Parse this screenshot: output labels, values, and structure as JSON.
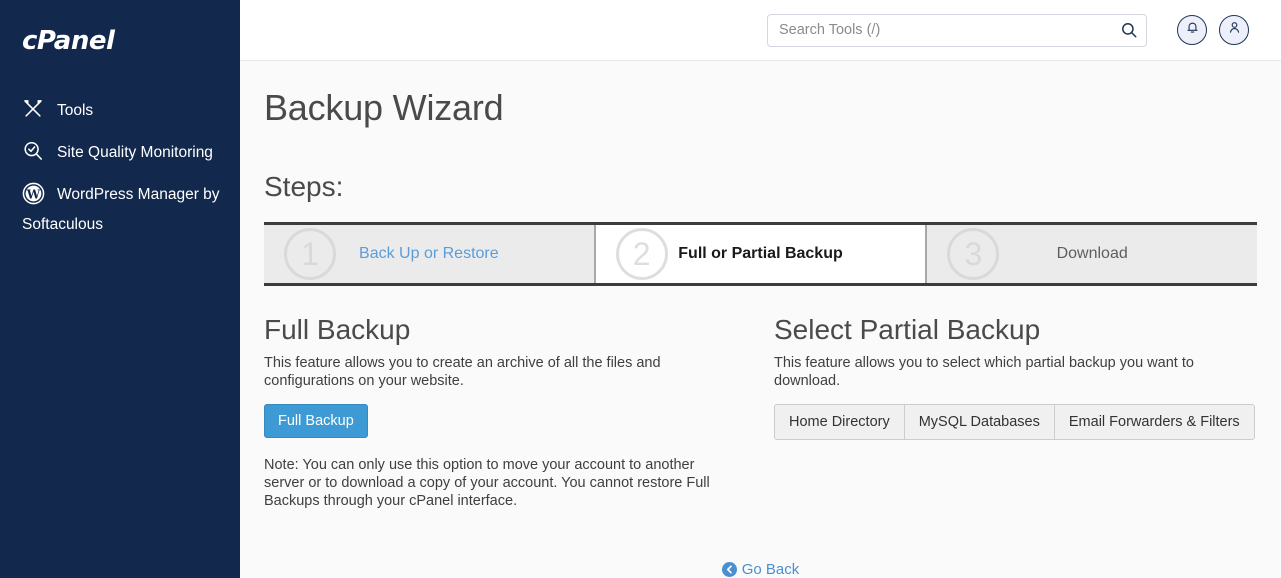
{
  "sidebar": {
    "brand": "cPanel",
    "items": [
      {
        "label": "Tools",
        "icon": "tools-icon"
      },
      {
        "label": "Site Quality Monitoring",
        "icon": "site-quality-icon"
      },
      {
        "label": "WordPress Manager by Softaculous",
        "icon": "wordpress-icon"
      }
    ]
  },
  "header": {
    "search": {
      "placeholder": "Search Tools (/)",
      "value": ""
    },
    "notifications_icon": "bell-icon",
    "account_icon": "user-icon"
  },
  "page": {
    "title": "Backup Wizard",
    "steps_title": "Steps:",
    "steps": [
      {
        "number": "1",
        "label": "Back Up or Restore",
        "state": "link"
      },
      {
        "number": "2",
        "label": "Full or Partial Backup",
        "state": "active"
      },
      {
        "number": "3",
        "label": "Download",
        "state": "inactive"
      }
    ],
    "full_backup": {
      "title": "Full Backup",
      "description": "This feature allows you to create an archive of all the files and configurations on your website.",
      "button": "Full Backup",
      "note": "Note: You can only use this option to move your account to another server or to download a copy of your account. You cannot restore Full Backups through your cPanel interface."
    },
    "partial_backup": {
      "title": "Select Partial Backup",
      "description": "This feature allows you to select which partial backup you want to download.",
      "buttons": [
        "Home Directory",
        "MySQL Databases",
        "Email Forwarders & Filters"
      ]
    },
    "go_back": "Go Back"
  },
  "colors": {
    "sidebar_bg": "#12284c",
    "primary_button": "#3d9ad4",
    "link": "#4a90cf",
    "content_bg": "#fafafa"
  }
}
